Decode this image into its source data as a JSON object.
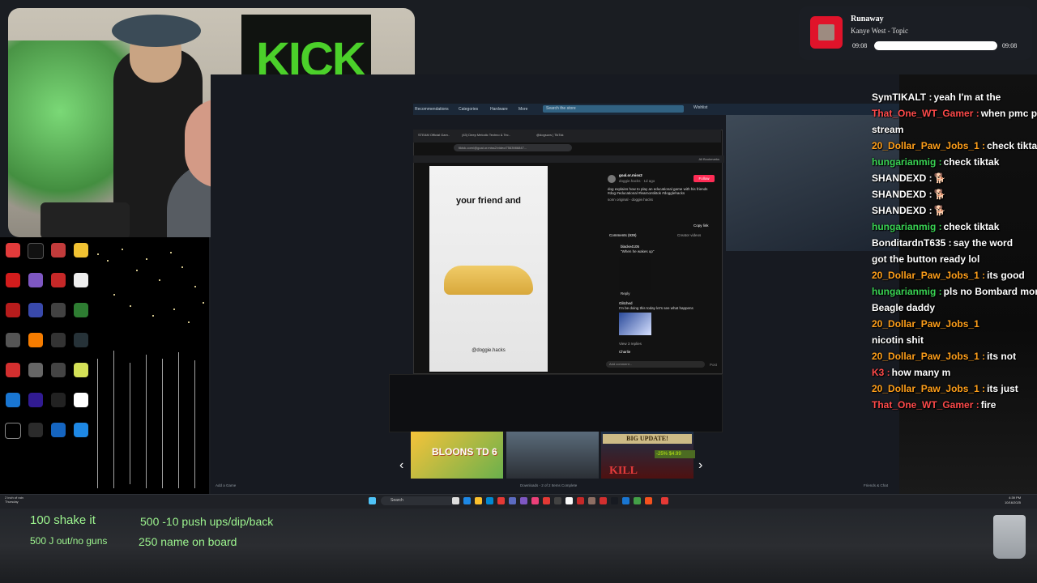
{
  "music": {
    "title": "Runaway",
    "artist": "Kanye West - Topic",
    "time_current": "09:08",
    "time_total": "09:08",
    "progress": 1.0,
    "accent": "#e0132a"
  },
  "webcam": {
    "banner": "KICK"
  },
  "store": {
    "nav": [
      "Recommendations",
      "Categories",
      "Hardware",
      "More"
    ],
    "search_placeholder": "Search the store",
    "wishlist": "Wishlist"
  },
  "tiktok": {
    "tabs": [
      "STEAM Official Gam..",
      "(43) Deep Melodic Techno & Tec..",
      "@dogsuvs | TikTok"
    ],
    "url": "tiktok.com/@goal.or.miss2/video/7563986847...",
    "bookmarks": "All Bookmarks",
    "video_caption": "your friend and",
    "video_handle": "@doggie.hacks",
    "author": "goal.or.miss2",
    "author_sub": "doggie.hacks · 1d ago",
    "follow": "Follow",
    "description": "dog explains how to play an educational game with his friends #dog #educational #learnontiktok #dogglehacks",
    "sound": "sonn original - doggie.hacks",
    "copy_link": "Copy link",
    "comments_tab": "Comments (939)",
    "creator_tab": "Creator videos",
    "comment1_user": "blacke4105",
    "comment1_text": "\"When he wakes up\"",
    "comment2_user": "Glitched",
    "comment2_text": "I'm be doing this today let's see what happens",
    "comment3_user": "Charlie",
    "reply": "Reply",
    "view_replies": "View 3 replies",
    "add_comment": "Add comment...",
    "post": "Post"
  },
  "games": {
    "game1_title": "BLOONS TD 6",
    "sale_banner": "BIG UPDATE!",
    "discount": "-25%  $4.99",
    "game3_title": "KILL"
  },
  "steam_footer": {
    "add_game": "Add a Game",
    "downloads": "Downloads - 2 of 2 Items Complete",
    "friends": "Friends & Chat"
  },
  "chat": [
    {
      "user": "SymTIKALT",
      "text": "yeah I'm at the",
      "color": "#ffffff"
    },
    {
      "user": "That_One_WT_Gamer",
      "text": "when pmc pi",
      "color": "#ff4a4a"
    },
    {
      "user": "",
      "text": "stream",
      "color": "#ffffff"
    },
    {
      "user": "20_Dollar_Paw_Jobs_1",
      "text": "check tiktak",
      "color": "#ff9f1a"
    },
    {
      "user": "hungarianmig",
      "text": "check tiktak",
      "color": "#39d353"
    },
    {
      "user": "SHANDEXD",
      "text": "🐕",
      "color": "#ffffff"
    },
    {
      "user": "SHANDEXD",
      "text": "🐕",
      "color": "#ffffff"
    },
    {
      "user": "SHANDEXD",
      "text": "🐕",
      "color": "#ffffff"
    },
    {
      "user": "hungarianmig",
      "text": "check tiktak",
      "color": "#39d353"
    },
    {
      "user": "BonditardnT635",
      "text": "say the word",
      "color": "#ffffff"
    },
    {
      "user": "",
      "text": "got the button ready lol",
      "color": "#ffffff"
    },
    {
      "user": "20_Dollar_Paw_Jobs_1",
      "text": "its good",
      "color": "#ff9f1a"
    },
    {
      "user": "hungarianmig",
      "text": "pls no Bombard mom",
      "color": "#39d353"
    },
    {
      "user": "",
      "text": "Beagle daddy",
      "color": "#ffffff"
    },
    {
      "user": "20_Dollar_Paw_Jobs_1",
      "text": "",
      "color": "#ff9f1a"
    },
    {
      "user": "",
      "text": "nicotin shit",
      "color": "#ffffff"
    },
    {
      "user": "20_Dollar_Paw_Jobs_1",
      "text": "its not",
      "color": "#ff9f1a"
    },
    {
      "user": "K3",
      "text": "how many m",
      "color": "#ff4a4a"
    },
    {
      "user": "20_Dollar_Paw_Jobs_1",
      "text": "its just",
      "color": "#ff9f1a"
    },
    {
      "user": "That_One_WT_Gamer",
      "text": "fire",
      "color": "#ff4a4a"
    }
  ],
  "taskbar": {
    "weather": "2 inch of rain",
    "weather_day": "Thursday",
    "search": "Search",
    "time": "4:39 PM",
    "date": "10/16/2025"
  },
  "goals": {
    "g1": "100 shake it",
    "g2": "500 -10 push ups/dip/back",
    "g3": "500 J out/no guns",
    "g4": "250 name on board"
  }
}
